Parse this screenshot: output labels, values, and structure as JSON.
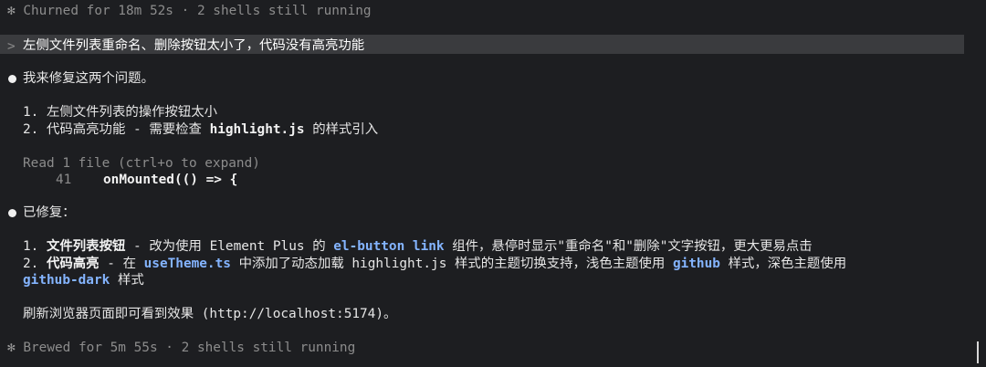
{
  "status_top": {
    "icon": "asterisk-spinner-icon",
    "text": "Churned for 18m 52s · 2 shells still running"
  },
  "prompt": {
    "caret": ">",
    "text": "左侧文件列表重命名、删除按钮太小了，代码没有高亮功能"
  },
  "message1": {
    "intro": "我来修复这两个问题。",
    "items": [
      "1. 左侧文件列表的操作按钮太小",
      {
        "prefix": "2. 代码高亮功能 - 需要检查 ",
        "code": "highlight.js",
        "suffix": " 的样式引入"
      }
    ]
  },
  "tool": {
    "header": "Read 1 file (ctrl+o to expand)",
    "line_no": "41",
    "line_text": "onMounted(() => {"
  },
  "message2": {
    "intro": "已修复：",
    "item1": {
      "num": "1.",
      "label": "文件列表按钮",
      "text_a": " - 改为使用 Element Plus 的 ",
      "code": "el-button link",
      "text_b": " 组件，悬停时显示\"重命名\"和\"删除\"文字按钮，更大更易点击"
    },
    "item2": {
      "num": "2.",
      "label": "代码高亮",
      "text_a": " - 在 ",
      "code_a": "useTheme.ts",
      "text_b": " 中添加了动态加载 highlight.js 样式的主题切换支持，浅色主题使用 ",
      "code_b": "github",
      "text_c": " 样式，深色主题使用",
      "code_c": "github-dark",
      "text_d": " 样式"
    },
    "footer": "刷新浏览器页面即可看到效果 (http://localhost:5174)。"
  },
  "status_bottom": {
    "icon": "asterisk-spinner-icon",
    "text": "Brewed for 5m 55s · 2 shells still running"
  }
}
